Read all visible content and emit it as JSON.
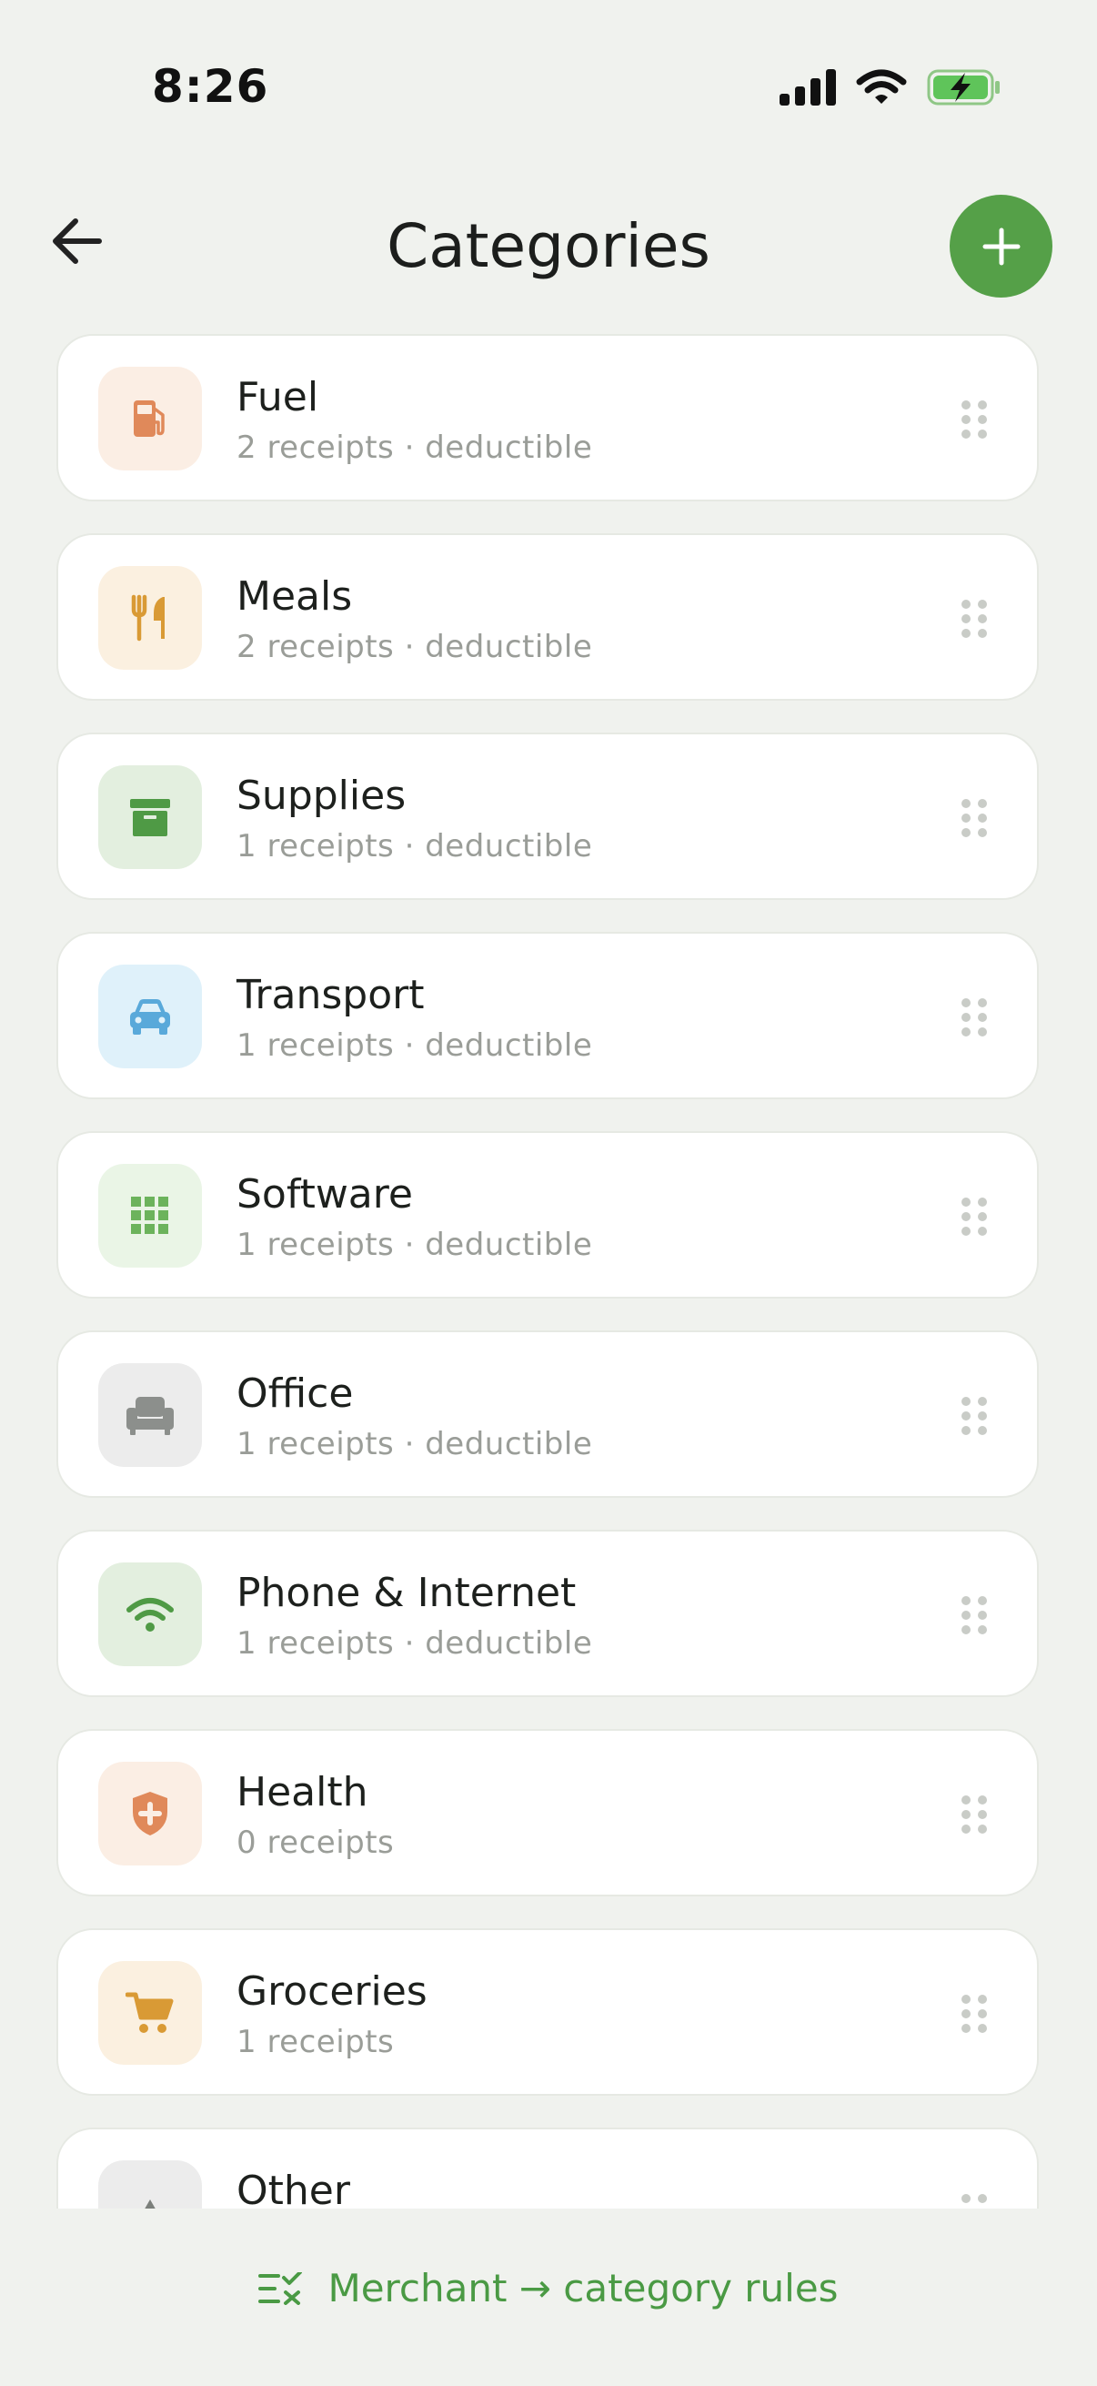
{
  "status_bar": {
    "time": "8:26"
  },
  "header": {
    "title": "Categories"
  },
  "categories": [
    {
      "name": "Fuel",
      "meta": "2 receipts · deductible",
      "icon": "fuel-pump-icon",
      "bg": "#fbeee4",
      "fg": "#e0895a"
    },
    {
      "name": "Meals",
      "meta": "2 receipts · deductible",
      "icon": "fork-knife-icon",
      "bg": "#fbf0e0",
      "fg": "#d99a35"
    },
    {
      "name": "Supplies",
      "meta": "1 receipts · deductible",
      "icon": "archive-box-icon",
      "bg": "#e3efdf",
      "fg": "#4f9a45"
    },
    {
      "name": "Transport",
      "meta": "1 receipts · deductible",
      "icon": "car-icon",
      "bg": "#dff1fa",
      "fg": "#59a9da"
    },
    {
      "name": "Software",
      "meta": "1 receipts · deductible",
      "icon": "app-grid-icon",
      "bg": "#eaf5e6",
      "fg": "#6cb35c"
    },
    {
      "name": "Office",
      "meta": "1 receipts · deductible",
      "icon": "armchair-icon",
      "bg": "#ececec",
      "fg": "#8c8f8c"
    },
    {
      "name": "Phone & Internet",
      "meta": "1 receipts · deductible",
      "icon": "wifi-icon",
      "bg": "#e3efdf",
      "fg": "#4f9a45"
    },
    {
      "name": "Health",
      "meta": "0 receipts",
      "icon": "medical-shield-icon",
      "bg": "#fbeee4",
      "fg": "#e0895a"
    },
    {
      "name": "Groceries",
      "meta": "1 receipts",
      "icon": "shopping-cart-icon",
      "bg": "#fbf0e0",
      "fg": "#d99a35"
    },
    {
      "name": "Other",
      "meta": "",
      "icon": "triangle-icon",
      "bg": "#ececec",
      "fg": "#7b7f7b"
    }
  ],
  "footer": {
    "rules_label": "Merchant → category rules"
  },
  "colors": {
    "accent": "#55a048",
    "link": "#4a9a44",
    "background": "#f0f2ee"
  }
}
